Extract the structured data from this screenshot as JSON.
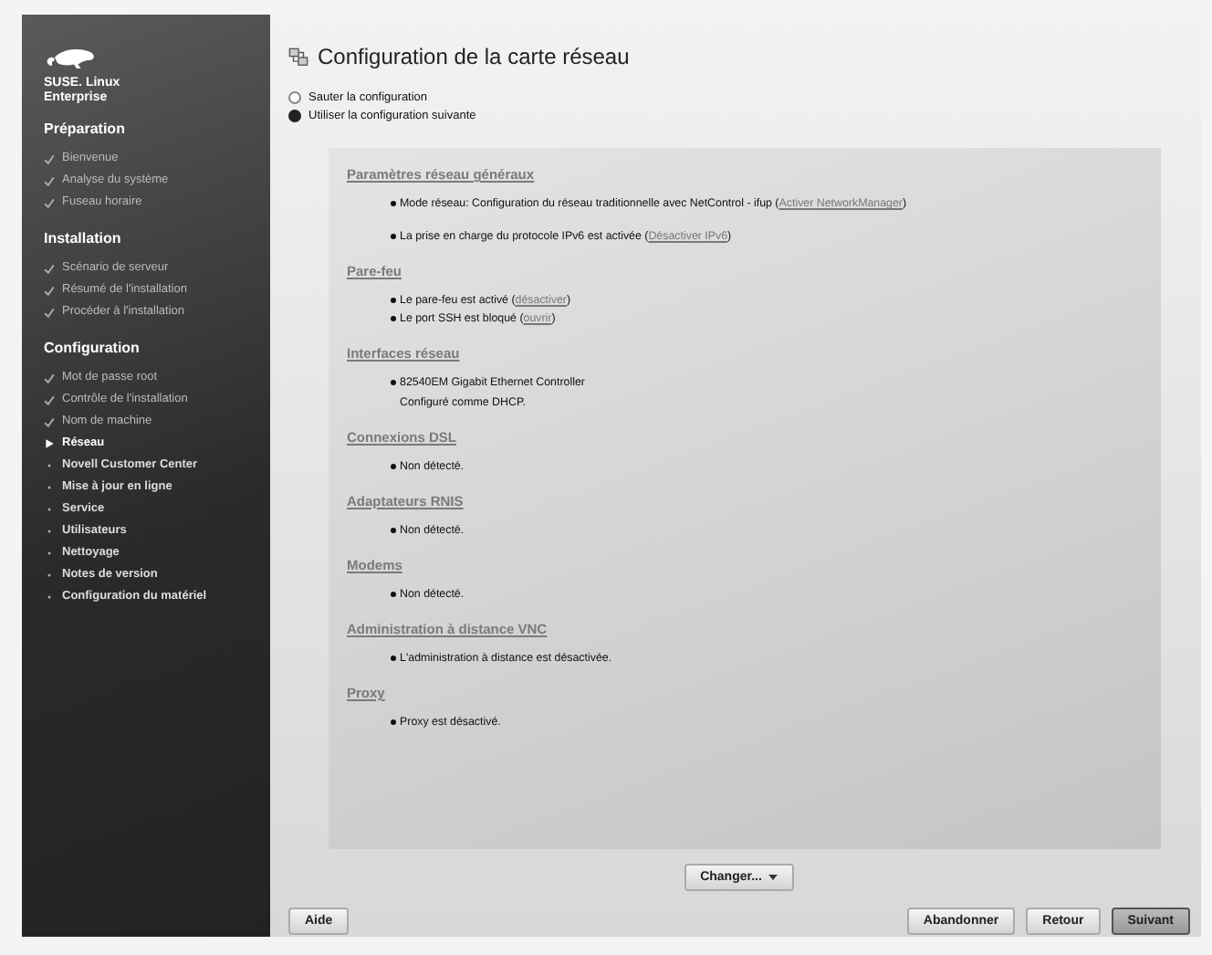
{
  "sidebar": {
    "logo_text": "SUSE. Linux Enterprise",
    "sections": [
      {
        "title": "Préparation",
        "items": [
          {
            "label": "Bienvenue",
            "kind": "done"
          },
          {
            "label": "Analyse du système",
            "kind": "done"
          },
          {
            "label": "Fuseau horaire",
            "kind": "done"
          }
        ]
      },
      {
        "title": "Installation",
        "items": [
          {
            "label": "Scénario de serveur",
            "kind": "done"
          },
          {
            "label": "Résumé de l'installation",
            "kind": "done"
          },
          {
            "label": "Procéder à l'installation",
            "kind": "done"
          }
        ]
      },
      {
        "title": "Configuration",
        "items": [
          {
            "label": "Mot de passe root",
            "kind": "done"
          },
          {
            "label": "Contrôle de l'installation",
            "kind": "done"
          },
          {
            "label": "Nom de machine",
            "kind": "done"
          },
          {
            "label": "Réseau",
            "kind": "current"
          },
          {
            "label": "Novell Customer Center",
            "kind": "pending"
          },
          {
            "label": "Mise à jour en ligne",
            "kind": "pending"
          },
          {
            "label": "Service",
            "kind": "pending"
          },
          {
            "label": "Utilisateurs",
            "kind": "pending"
          },
          {
            "label": "Nettoyage",
            "kind": "pending"
          },
          {
            "label": "Notes de version",
            "kind": "pending"
          },
          {
            "label": "Configuration du matériel",
            "kind": "pending"
          }
        ]
      }
    ]
  },
  "title": "Configuration de la carte réseau",
  "options": [
    {
      "label": "Sauter la configuration",
      "selected": false
    },
    {
      "label": "Utiliser la configuration suivante",
      "selected": true
    }
  ],
  "sections": [
    {
      "heading": "Paramètres réseau généraux",
      "items": [
        {
          "prefix": "Mode réseau: Configuration du réseau traditionnelle avec NetControl - ifup (",
          "link": "Activer NetworkManager",
          "suffix": ")"
        },
        {
          "prefix": "La prise en charge du protocole IPv6 est activée (",
          "link": "Désactiver IPv6",
          "suffix": ")"
        }
      ]
    },
    {
      "heading": "Pare-feu",
      "items": [
        {
          "prefix": "Le pare-feu est activé (",
          "link": "désactiver",
          "suffix": ")"
        },
        {
          "prefix": "Le port SSH est bloqué (",
          "link": "ouvrir",
          "suffix": ")"
        }
      ]
    },
    {
      "heading": "Interfaces réseau",
      "items": [
        {
          "prefix": "82540EM Gigabit Ethernet Controller",
          "note": "Configuré comme DHCP."
        }
      ]
    },
    {
      "heading": "Connexions DSL",
      "items": [
        {
          "prefix": "Non détecté."
        }
      ]
    },
    {
      "heading": "Adaptateurs RNIS",
      "items": [
        {
          "prefix": "Non détecté."
        }
      ]
    },
    {
      "heading": "Modems",
      "items": [
        {
          "prefix": "Non détecté."
        }
      ]
    },
    {
      "heading": "Administration à distance VNC",
      "items": [
        {
          "prefix": "L'administration à distance est désactivée."
        }
      ]
    },
    {
      "heading": "Proxy",
      "items": [
        {
          "prefix": "Proxy est désactivé."
        }
      ]
    }
  ],
  "change_button": "Changer...",
  "help_button": "Aide",
  "buttons": [
    {
      "label": "Abandonner",
      "default": false
    },
    {
      "label": "Retour",
      "default": false
    },
    {
      "label": "Suivant",
      "default": true
    }
  ]
}
